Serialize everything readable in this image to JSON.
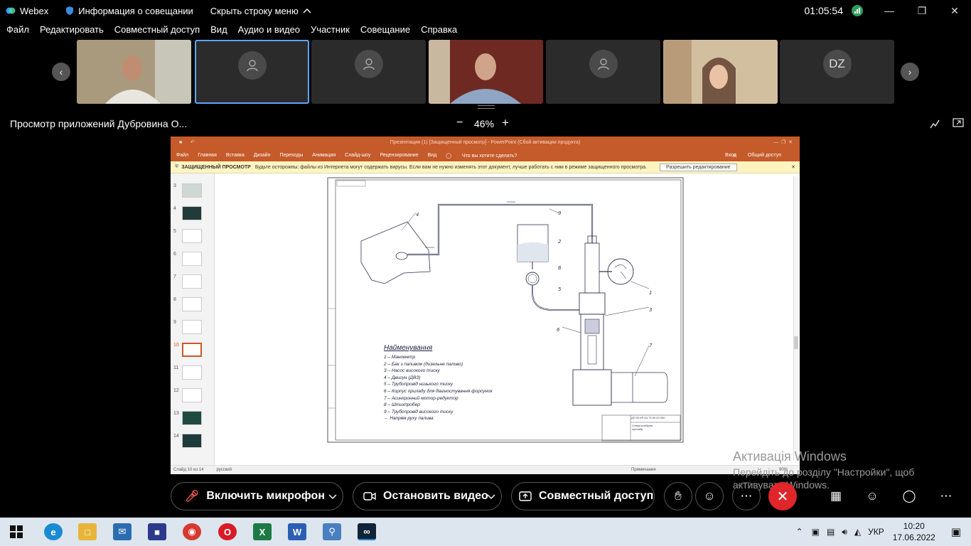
{
  "titlebar": {
    "app": "Webex",
    "meeting_info": "Информация о совещании",
    "hide_menu": "Скрыть строку меню",
    "time": "01:05:54"
  },
  "menu": [
    "Файл",
    "Редактировать",
    "Совместный доступ",
    "Вид",
    "Аудио и видео",
    "Участник",
    "Совещание",
    "Справка"
  ],
  "participants": [
    {
      "type": "video",
      "color": "#9a8a72"
    },
    {
      "type": "avatar",
      "selected": true
    },
    {
      "type": "avatar"
    },
    {
      "type": "video",
      "color": "#7a3a30"
    },
    {
      "type": "avatar"
    },
    {
      "type": "video",
      "color": "#c8b28e"
    },
    {
      "type": "initials",
      "initials": "DZ"
    }
  ],
  "view": {
    "title": "Просмотр приложений Дубровина О...",
    "zoom_minus": "−",
    "zoom": "46%",
    "zoom_plus": "+"
  },
  "ppt": {
    "title": "Презентация (1) [Защищенный просмотр] - PowerPoint (Сбой активации продукта)",
    "ribbon": [
      "Файл",
      "Главная",
      "Вставка",
      "Дизайн",
      "Переходы",
      "Анимация",
      "Слайд-шоу",
      "Рецензирование",
      "Вид",
      "Что вы хотите сделать?"
    ],
    "login": "Вход",
    "share": "Общий доступ",
    "warn_title": "ЗАЩИЩЕННЫЙ ПРОСМОТР",
    "warn_text": "Будьте осторожны: файлы из Интернета могут содержать вирусы. Если вам не нужно изменять этот документ, лучше работать с ним в режиме защищенного просмотра.",
    "warn_button": "Разрешить редактирование",
    "slides": [
      "3",
      "4",
      "5",
      "6",
      "7",
      "8",
      "9",
      "10",
      "11",
      "12",
      "13",
      "14"
    ],
    "status_slide": "Слайд 10 из 14",
    "status_lang": "русский",
    "status_notes": "Примечания",
    "status_zoom": "90%",
    "legend_title": "Найменування",
    "legend": [
      "1 – Манометр",
      "2 – Бак з паливом (дизельне паливо)",
      "3 – Насос високого тиску",
      "4 – Двигун (ДВЗ)",
      "5 – Трубопровід низького тиску",
      "6 – Корпус приладу для діагностування форсунок",
      "7 – Асинхронний мотор-редуктор",
      "8 – Штихпробер",
      "9 – Трубопровід високого тиску",
      "Напрям руху палива"
    ],
    "stamp_code": "ДП 02.КР-04.73.00.00.000",
    "stamp_name": "Схема розбірна приладу"
  },
  "controls": {
    "mic": "Включить микрофон",
    "video": "Остановить видео",
    "share": "Совместный доступ"
  },
  "activation": {
    "line1": "Активація Windows",
    "line2": "Перейдіть до розділу \"Настройки\", щоб",
    "line3": "активувати Windows."
  },
  "taskbar": {
    "lang": "УКР",
    "time": "10:20",
    "date": "17.06.2022"
  }
}
